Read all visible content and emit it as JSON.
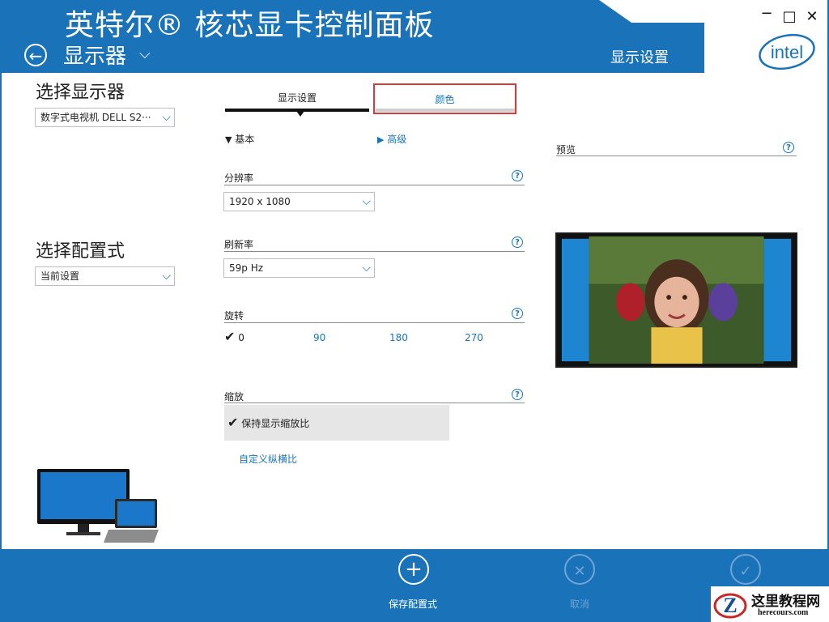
{
  "header": {
    "app_title": "英特尔® 核芯显卡控制面板",
    "section_title": "显示器",
    "active_header_tab": "显示设置",
    "logo_text": "intel"
  },
  "window_controls": {
    "minimize": "−",
    "maximize": "□",
    "close": "✕"
  },
  "left_panel": {
    "select_display_heading": "选择显示器",
    "display_select_value": "数字式电视机 DELL S2···",
    "select_profile_heading": "选择配置式",
    "profile_select_value": "当前设置"
  },
  "tabs": [
    {
      "label": "显示设置",
      "active": true
    },
    {
      "label": "颜色",
      "active": false
    }
  ],
  "toggles": {
    "basic": "基本",
    "advanced": "高级"
  },
  "settings": {
    "resolution_label": "分辨率",
    "resolution_value": "1920 x 1080",
    "refresh_label": "刷新率",
    "refresh_value": "59p Hz",
    "rotation_label": "旋转",
    "rotation_options": [
      "0",
      "90",
      "180",
      "270"
    ],
    "rotation_selected": "0",
    "scaling_label": "缩放",
    "scaling_option": "保持显示缩放比",
    "custom_ratio_link": "自定义纵横比"
  },
  "preview": {
    "label": "预览"
  },
  "footer": {
    "save_profile": "保存配置式",
    "cancel": "取消",
    "apply": "应用"
  },
  "watermark": {
    "cn": "这里教程网",
    "url": "herecours.com"
  },
  "colors": {
    "brand_blue": "#1a73b8",
    "tab_highlight_red": "#d8393a",
    "disabled_icon": "#6fa4d6"
  }
}
